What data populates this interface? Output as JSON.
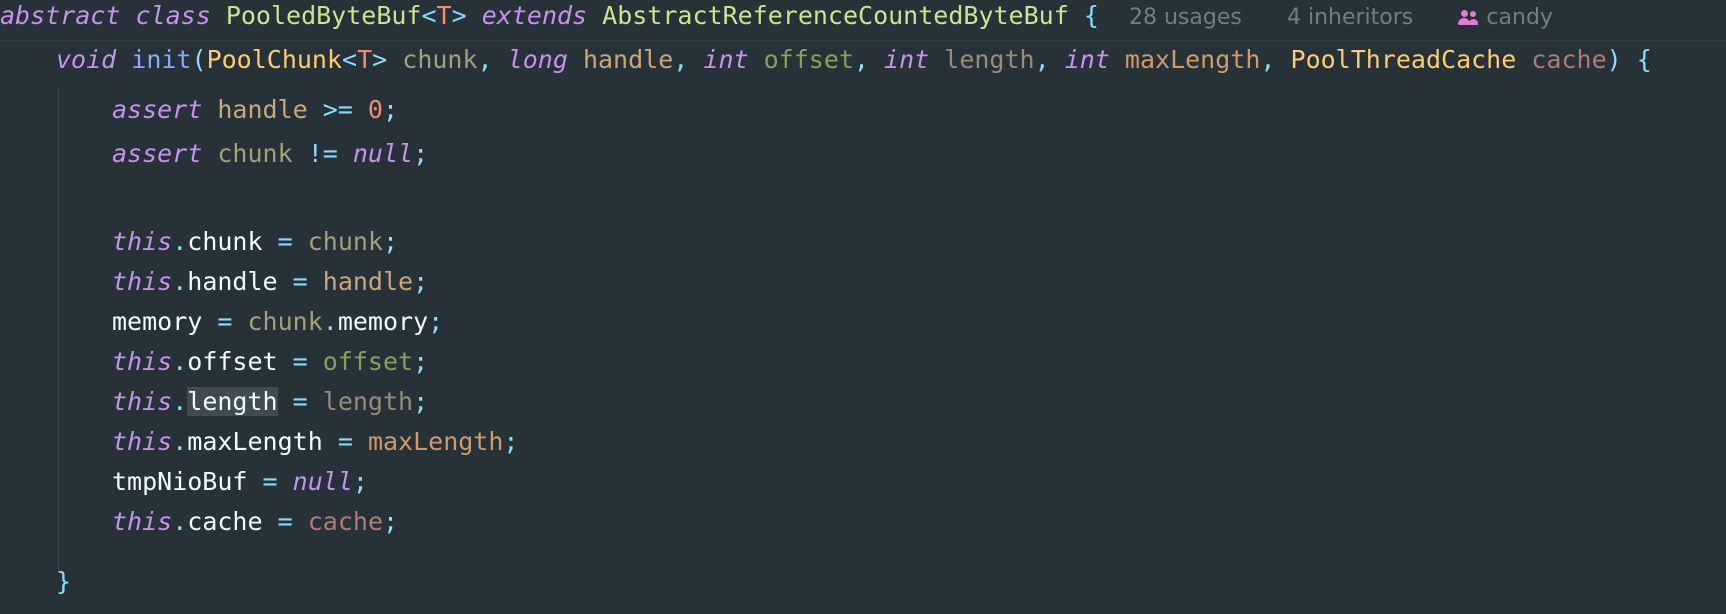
{
  "header": {
    "kw_abstract": "abstract",
    "kw_class": "class",
    "class_name": "PooledByteBuf",
    "generic_open": "<",
    "generic_T": "T",
    "generic_close": ">",
    "kw_extends": "extends",
    "super_class": "AbstractReferenceCountedByteBuf",
    "brace_open": "{",
    "usages": "28 usages",
    "inheritors": "4 inheritors",
    "author": "candy",
    "author_icon": "users-icon"
  },
  "signature": {
    "kw_void": "void",
    "method_name": "init",
    "paren_open": "(",
    "type_poolchunk": "PoolChunk",
    "lt": "<",
    "t": "T",
    "gt": ">",
    "p_chunk": "chunk",
    "comma1": ",",
    "kw_long": "long",
    "p_handle": "handle",
    "comma2": ",",
    "kw_int1": "int",
    "p_offset": "offset",
    "comma3": ",",
    "kw_int2": "int",
    "p_length": "length",
    "comma4": ",",
    "kw_int3": "int",
    "p_maxLength": "maxLength",
    "comma5": ",",
    "type_cache": "PoolThreadCache",
    "p_cache": "cache",
    "paren_close": ")",
    "brace_open": "{"
  },
  "body": {
    "l1": {
      "kw": "assert",
      "var": "handle",
      "op": ">=",
      "num": "0",
      "semi": ";"
    },
    "l2": {
      "kw": "assert",
      "var": "chunk",
      "op": "!=",
      "kw2": "null",
      "semi": ";"
    },
    "l3": {
      "this": "this",
      "dot": ".",
      "field": "chunk",
      "eq": "=",
      "val": "chunk",
      "semi": ";"
    },
    "l4": {
      "this": "this",
      "dot": ".",
      "field": "handle",
      "eq": "=",
      "val": "handle",
      "semi": ";"
    },
    "l5": {
      "field": "memory",
      "eq": "=",
      "obj": "chunk",
      "dot": ".",
      "member": "memory",
      "semi": ";"
    },
    "l6": {
      "this": "this",
      "dot": ".",
      "field": "offset",
      "eq": "=",
      "val": "offset",
      "semi": ";"
    },
    "l7": {
      "this": "this",
      "dot": ".",
      "field": "length",
      "eq": "=",
      "val": "length",
      "semi": ";"
    },
    "l8": {
      "this": "this",
      "dot": ".",
      "field": "maxLength",
      "eq": "=",
      "val": "maxLength",
      "semi": ";"
    },
    "l9": {
      "field": "tmpNioBuf",
      "eq": "=",
      "kw": "null",
      "semi": ";"
    },
    "l10": {
      "this": "this",
      "dot": ".",
      "field": "cache",
      "eq": "=",
      "val": "cache",
      "semi": ";"
    }
  },
  "closing": {
    "brace_close": "}"
  },
  "colors": {
    "background": "#263238",
    "keyword": "#C792EA",
    "type": "#FFCB6B",
    "function": "#82AAFF",
    "number": "#F78C6C",
    "punctuation": "#89DDFF"
  }
}
